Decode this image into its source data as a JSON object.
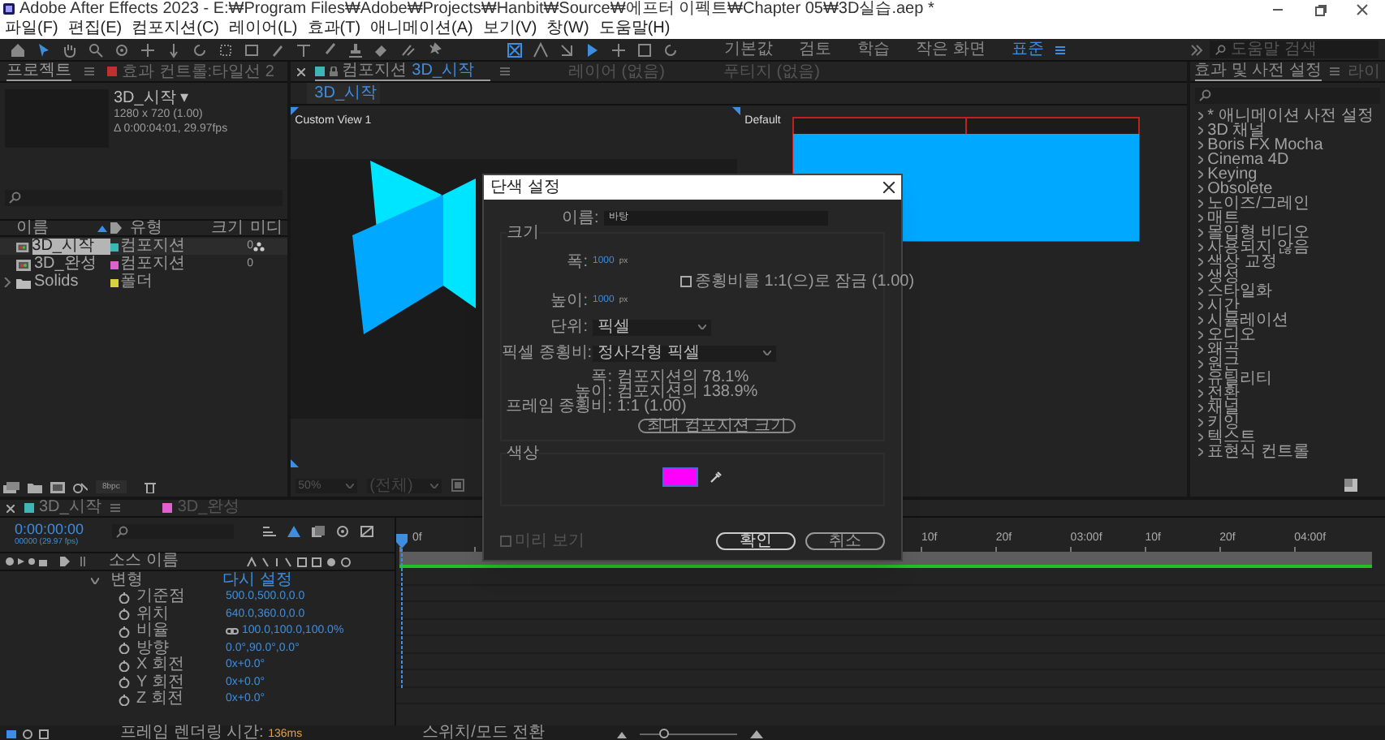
{
  "title_bar": {
    "title": "Adobe After Effects 2023 - E:₩Program Files₩Adobe₩Projects₩Hanbit₩Source₩에프터 이펙트₩Chapter 05₩3D실습.aep *"
  },
  "menu": [
    "파일(F)",
    "편집(E)",
    "컴포지션(C)",
    "레이어(L)",
    "효과(T)",
    "애니메이션(A)",
    "보기(V)",
    "창(W)",
    "도움말(H)"
  ],
  "workspaces": [
    {
      "label": "기본값",
      "selected": false
    },
    {
      "label": "검토",
      "selected": false
    },
    {
      "label": "학습",
      "selected": false
    },
    {
      "label": "작은 화면",
      "selected": false
    },
    {
      "label": "표준",
      "selected": true
    }
  ],
  "help_search": {
    "placeholder": "도움말 검색"
  },
  "project_panel": {
    "tabs": [
      {
        "label": "프로젝트",
        "selected": true
      },
      {
        "label": "효과 컨트롤:타일선 2",
        "selected": false
      }
    ],
    "comp_name": "3D_시작 ▾",
    "comp_size": "1280 x 720 (1.00)",
    "comp_duration": "Δ 0:00:04:01, 29.97fps",
    "columns": [
      "이름",
      "유형",
      "크기",
      "미디"
    ],
    "rows": [
      {
        "kind": "comp",
        "name": "3D_시작",
        "type": "컴포지션",
        "size": "0",
        "color": "#3fb5b5",
        "selected": true
      },
      {
        "kind": "comp",
        "name": "3D_완성",
        "type": "컴포지션",
        "size": "0",
        "color": "#e060d0",
        "selected": false
      },
      {
        "kind": "folder",
        "name": "Solids",
        "type": "폴더",
        "color": "#d8d040",
        "selected": false
      }
    ],
    "bit_depth": "8bpc"
  },
  "viewer": {
    "tabs": [
      {
        "label": "컴포지션",
        "comp": "3D_시작",
        "selected": true
      },
      {
        "label": "레이어 (없음)",
        "selected": false
      },
      {
        "label": "푸티지 (없음)",
        "selected": false
      }
    ],
    "breadcrumb": "3D_시작",
    "views": [
      "Custom View 1",
      "Default"
    ],
    "zoom": "50%",
    "resolution": "(전체)"
  },
  "effects_panel": {
    "tabs": [
      {
        "label": "효과 및 사전 설정",
        "selected": true
      },
      {
        "label": "라이",
        "selected": false
      }
    ],
    "items": [
      "* 애니메이션 사전 설정",
      "3D 채널",
      "Boris FX Mocha",
      "Cinema 4D",
      "Keying",
      "Obsolete",
      "노이즈/그레인",
      "매트",
      "몰입형 비디오",
      "사용되지 않음",
      "색상 교정",
      "생성",
      "스타일화",
      "시간",
      "시뮬레이션",
      "오디오",
      "왜곡",
      "원근",
      "유틸리티",
      "전환",
      "채널",
      "키잉",
      "텍스트",
      "표현식 컨트롤"
    ]
  },
  "dialog": {
    "title": "단색 설정",
    "name_label": "이름:",
    "name_value": "바탕",
    "size_section": "크기",
    "width_label": "폭:",
    "width_value": "1000",
    "width_unit": "px",
    "height_label": "높이:",
    "height_value": "1000",
    "height_unit": "px",
    "lock_label": "종횡비를 1:1(으)로 잠금 (1.00)",
    "lock_checked": false,
    "units_label": "단위:",
    "units_value": "픽셀",
    "par_label": "픽셀 종횡비:",
    "par_value": "정사각형 픽셀",
    "info": [
      {
        "label": "폭:",
        "value": "컴포지션의 78.1%"
      },
      {
        "label": "높이:",
        "value": "컴포지션의 138.9%"
      },
      {
        "label": "프레임 종횡비:",
        "value": "1:1 (1.00)"
      }
    ],
    "max_button": "최대 컴포지션 크기",
    "color_section": "색상",
    "color": "#ff00ff",
    "preview_label": "미리 보기",
    "preview_checked": false,
    "ok": "확인",
    "cancel": "취소"
  },
  "timeline": {
    "tabs": [
      {
        "label": "3D_시작",
        "color": "#3fb5b5",
        "selected": true
      },
      {
        "label": "3D_완성",
        "color": "#e060d0",
        "selected": false
      }
    ],
    "timecode": "0:00:00:00",
    "frame_info": "00000 (29.97 fps)",
    "source_name_header": "소스 이름",
    "group": {
      "label": "변형",
      "value": "다시 설정",
      "expanded": true
    },
    "properties": [
      {
        "label": "기준점",
        "value": "500.0,500.0,0.0"
      },
      {
        "label": "위치",
        "value": "640.0,360.0,0.0"
      },
      {
        "label": "비율",
        "value": "100.0,100.0,100.0%",
        "linked": true
      },
      {
        "label": "방향",
        "value": "0.0°,90.0°,0.0°"
      },
      {
        "label": "X 회전",
        "value": "0x+0.0°"
      },
      {
        "label": "Y 회전",
        "value": "0x+0.0°"
      },
      {
        "label": "Z 회전",
        "value": "0x+0.0°"
      }
    ],
    "ruler_start": [
      "0f"
    ],
    "ruler_end": [
      "10f",
      "20f",
      "03:00f",
      "10f",
      "20f",
      "04:00f"
    ]
  },
  "status_bar": {
    "render_label": "프레임 렌더링 시간:",
    "render_time": "136ms",
    "toggle": "스위치/모드 전환",
    "zoom_slider": {
      "level": 0.2
    }
  }
}
